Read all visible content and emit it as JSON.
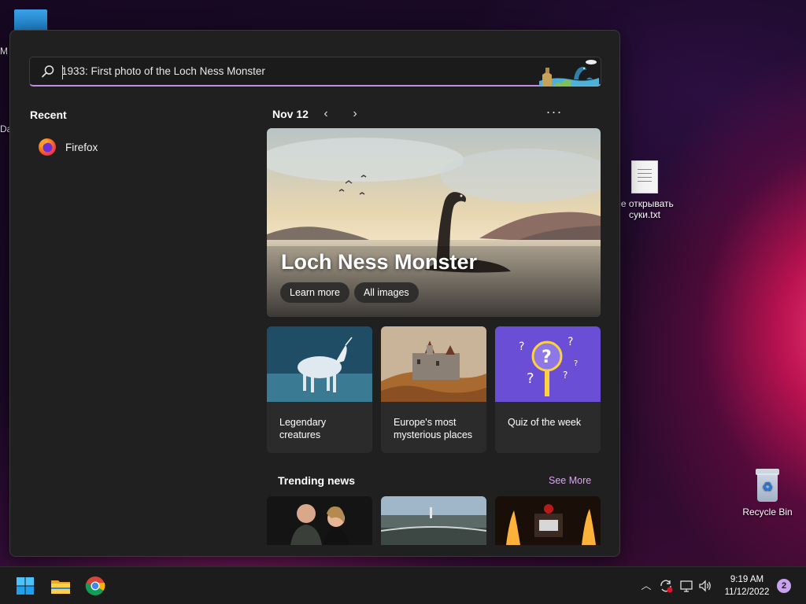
{
  "desktop": {
    "left_text_1": "M",
    "left_text_2": "Da",
    "txt_file_line1": "не открывать",
    "txt_file_line2": "суки.txt",
    "recycle_bin_label": "Recycle Bin"
  },
  "search": {
    "value": "1933: First photo of the Loch Ness Monster",
    "search_icon": "search-icon",
    "doodle_icon": "loch-ness-doodle-icon"
  },
  "recent": {
    "title": "Recent",
    "items": [
      {
        "label": "Firefox",
        "icon": "firefox-icon"
      }
    ]
  },
  "highlights": {
    "date": "Nov 12",
    "prev_icon": "‹",
    "next_icon": "›",
    "more_icon": "···",
    "hero": {
      "title": "Loch Ness Monster",
      "learn_more": "Learn more",
      "all_images": "All images"
    },
    "cards": [
      {
        "caption": "Legendary creatures"
      },
      {
        "caption": "Europe's most mysterious places"
      },
      {
        "caption": "Quiz of the week"
      }
    ],
    "trending_title": "Trending news",
    "see_more": "See More"
  },
  "taskbar": {
    "start_icon": "windows-start-icon",
    "explorer_icon": "file-explorer-icon",
    "chrome_icon": "chrome-icon",
    "tray_up": "︿",
    "time": "9:19 AM",
    "date": "11/12/2022",
    "notification_count": "2"
  },
  "colors": {
    "accent": "#c38de0",
    "panel_bg": "#202020",
    "taskbar_bg": "#1c1c1c"
  }
}
